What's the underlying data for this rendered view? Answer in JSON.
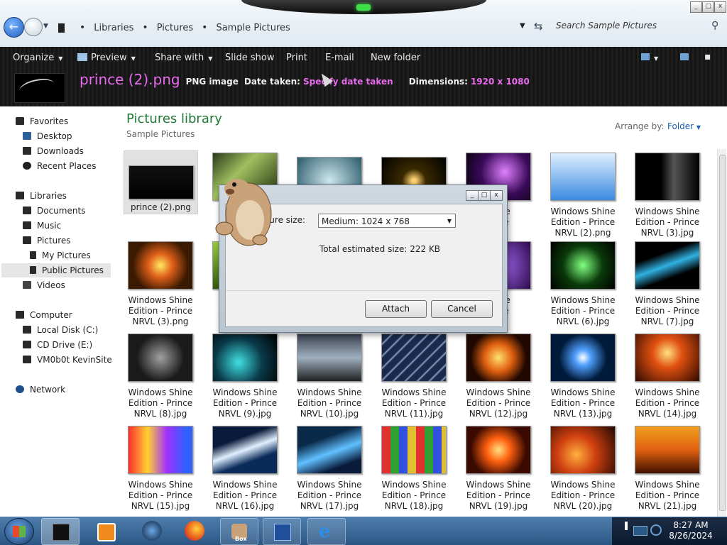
{
  "window": {
    "minimize": "0",
    "maximize": "1",
    "close": "r"
  },
  "address": {
    "breadcrumbs": [
      "Libraries",
      "Pictures",
      "Sample Pictures"
    ],
    "search_placeholder": "Search Sample Pictures"
  },
  "toolbar": {
    "organize": "Organize",
    "preview": "Preview",
    "share_with": "Share with",
    "slide_show": "Slide show",
    "print": "Print",
    "email": "E-mail",
    "new_folder": "New folder"
  },
  "details": {
    "file_name": "prince (2).png",
    "file_type": "PNG image",
    "date_label": "Date taken:",
    "date_value": "Specify date taken",
    "dims_label": "Dimensions:",
    "dims_value": "1920 x 1080"
  },
  "nav": {
    "favorites": "Favorites",
    "desktop": "Desktop",
    "downloads": "Downloads",
    "recent": "Recent Places",
    "libraries": "Libraries",
    "documents": "Documents",
    "music": "Music",
    "pictures": "Pictures",
    "my_pictures": "My Pictures",
    "public_pictures": "Public Pictures",
    "videos": "Videos",
    "computer": "Computer",
    "local_disk": "Local Disk (C:)",
    "cd_drive": "CD Drive (E:)",
    "vm": "VM0b0t KevinSite",
    "network": "Network"
  },
  "library": {
    "title": "Pictures library",
    "subtitle": "Sample Pictures",
    "arrange_label": "Arrange by:",
    "arrange_value": "Folder"
  },
  "tiles": [
    {
      "l1": "prince (2).png",
      "l2": "",
      "l3": ""
    },
    {
      "l1": "",
      "l2": "",
      "l3": ""
    },
    {
      "l1": "",
      "l2": "",
      "l3": ""
    },
    {
      "l1": "",
      "l2": "",
      "l3": ""
    },
    {
      "l1": "Shine",
      "l2": "rince",
      "l3": ""
    },
    {
      "l1": "Windows Shine",
      "l2": "Edition - Prince",
      "l3": "NRVL (2).png"
    },
    {
      "l1": "Windows Shine",
      "l2": "Edition - Prince",
      "l3": "NRVL (3).jpg"
    },
    {
      "l1": "Windows Shine",
      "l2": "Edition - Prince",
      "l3": "NRVL (3).png"
    },
    {
      "l1": "W",
      "l2": "E",
      "l3": ""
    },
    {
      "l1": "",
      "l2": "",
      "l3": ""
    },
    {
      "l1": "",
      "l2": "",
      "l3": ""
    },
    {
      "l1": "Shine",
      "l2": "rince",
      "l3": "png"
    },
    {
      "l1": "Windows Shine",
      "l2": "Edition - Prince",
      "l3": "NRVL (6).jpg"
    },
    {
      "l1": "Windows Shine",
      "l2": "Edition - Prince",
      "l3": "NRVL (7).jpg"
    },
    {
      "l1": "Windows Shine",
      "l2": "Edition - Prince",
      "l3": "NRVL (8).jpg"
    },
    {
      "l1": "Windows Shine",
      "l2": "Edition - Prince",
      "l3": "NRVL (9).jpg"
    },
    {
      "l1": "Windows Shine",
      "l2": "Edition - Prince",
      "l3": "NRVL (10).jpg"
    },
    {
      "l1": "Windows Shine",
      "l2": "Edition - Prince",
      "l3": "NRVL (11).jpg"
    },
    {
      "l1": "Windows Shine",
      "l2": "Edition - Prince",
      "l3": "NRVL (12).jpg"
    },
    {
      "l1": "Windows Shine",
      "l2": "Edition - Prince",
      "l3": "NRVL (13).jpg"
    },
    {
      "l1": "Windows Shine",
      "l2": "Edition - Prince",
      "l3": "NRVL (14).jpg"
    },
    {
      "l1": "Windows Shine",
      "l2": "Edition - Prince",
      "l3": "NRVL (15).jpg"
    },
    {
      "l1": "Windows Shine",
      "l2": "Edition - Prince",
      "l3": "NRVL (16).jpg"
    },
    {
      "l1": "Windows Shine",
      "l2": "Edition - Prince",
      "l3": "NRVL (17).jpg"
    },
    {
      "l1": "Windows Shine",
      "l2": "Edition - Prince",
      "l3": "NRVL (18).jpg"
    },
    {
      "l1": "Windows Shine",
      "l2": "Edition - Prince",
      "l3": "NRVL (19).jpg"
    },
    {
      "l1": "Windows Shine",
      "l2": "Edition - Prince",
      "l3": "NRVL (20).jpg"
    },
    {
      "l1": "Windows Shine",
      "l2": "Edition - Prince",
      "l3": "NRVL (21).jpg"
    }
  ],
  "dialog": {
    "title": "A",
    "picture_size_label": "cture size:",
    "picture_size_value": "Medium: 1024 x 768",
    "total_label": "Total estimated size:",
    "total_value": "222 KB",
    "attach": "Attach",
    "cancel": "Cancel",
    "minimize": "0",
    "maximize": "1",
    "close": "r"
  },
  "taskbar": {
    "box_label": "Box"
  },
  "clock": {
    "time": "8:27 AM",
    "date": "8/26/2024"
  },
  "colors": {
    "accent": "#e86aee",
    "library_title": "#1f7a35",
    "link": "#1a5fb4"
  }
}
